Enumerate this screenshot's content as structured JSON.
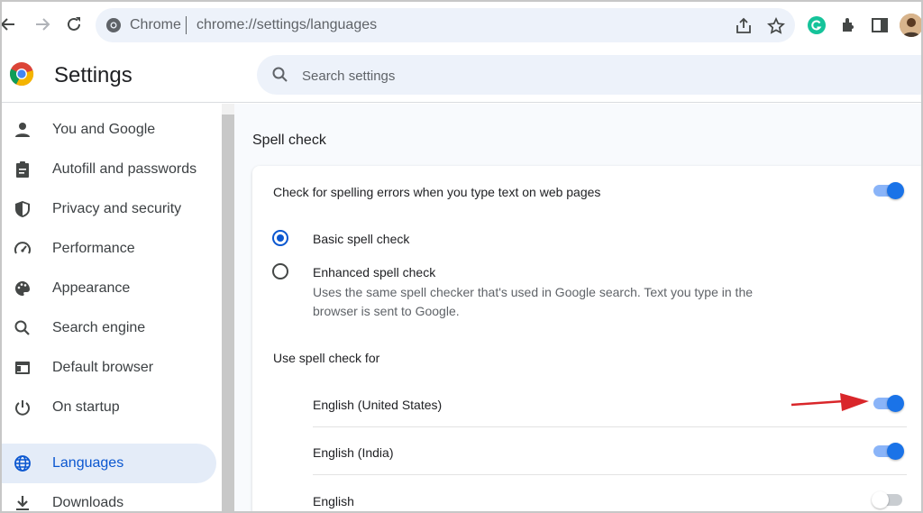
{
  "toolbar": {
    "site_chip": "Chrome",
    "url": "chrome://settings/languages",
    "icons": [
      "back-icon",
      "forward-icon",
      "reload-icon",
      "share-icon",
      "bookmark-star-icon",
      "grammarly-icon",
      "extensions-icon",
      "side-panel-icon",
      "profile-avatar"
    ]
  },
  "header": {
    "title": "Settings",
    "search_placeholder": "Search settings"
  },
  "sidebar": {
    "items": [
      {
        "label": "You and Google",
        "icon": "person-icon",
        "active": false
      },
      {
        "label": "Autofill and passwords",
        "icon": "clipboard-icon",
        "active": false
      },
      {
        "label": "Privacy and security",
        "icon": "shield-icon",
        "active": false
      },
      {
        "label": "Performance",
        "icon": "speedometer-icon",
        "active": false
      },
      {
        "label": "Appearance",
        "icon": "palette-icon",
        "active": false
      },
      {
        "label": "Search engine",
        "icon": "search-icon",
        "active": false
      },
      {
        "label": "Default browser",
        "icon": "browser-icon",
        "active": false
      },
      {
        "label": "On startup",
        "icon": "power-icon",
        "active": false
      },
      {
        "label": "Languages",
        "icon": "globe-icon",
        "active": true
      },
      {
        "label": "Downloads",
        "icon": "download-icon",
        "active": false
      }
    ]
  },
  "main": {
    "section_title": "Spell check",
    "spell_check_toggle_label": "Check for spelling errors when you type text on web pages",
    "spell_check_enabled": true,
    "basic_label": "Basic spell check",
    "basic_selected": true,
    "enhanced_label": "Enhanced spell check",
    "enhanced_desc_line1": "Uses the same spell checker that's used in Google search. Text you type in the",
    "enhanced_desc_line2": "browser is sent to Google.",
    "enhanced_selected": false,
    "use_for_label": "Use spell check for",
    "languages": [
      {
        "label": "English (United States)",
        "enabled": true
      },
      {
        "label": "English (India)",
        "enabled": true
      },
      {
        "label": "English",
        "enabled": false
      }
    ]
  },
  "colors": {
    "accent": "#0b57d0",
    "toggle_on": "#1a73e8",
    "annotation_arrow": "#d9262a"
  }
}
